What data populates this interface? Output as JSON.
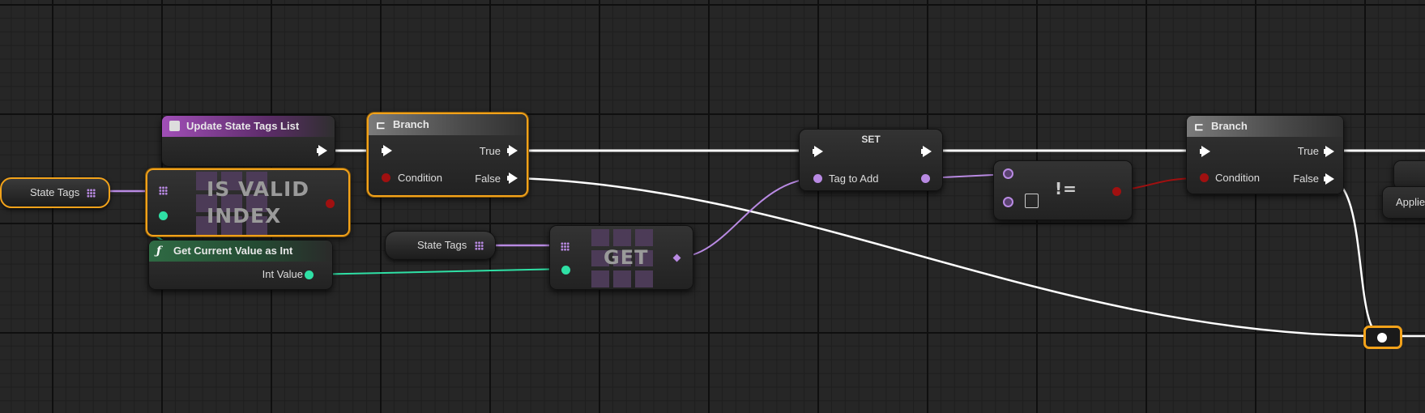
{
  "canvas": {
    "wire_exec_color": "#ffffff",
    "wire_array_color": "#b98ae3",
    "wire_int_color": "#2fe0a5",
    "wire_bool_color": "#a01010",
    "selection_color": "#f2a21a"
  },
  "nodes": {
    "update_state_tags": {
      "title": "Update State Tags List",
      "icon": "function-box-icon"
    },
    "branch1": {
      "title": "Branch",
      "pin_true": "True",
      "pin_false": "False",
      "pin_condition": "Condition"
    },
    "is_valid_index": {
      "op_line1": "IS VALID",
      "op_line2": "INDEX"
    },
    "state_tags_var1": {
      "label": "State Tags"
    },
    "state_tags_var2": {
      "label": "State Tags"
    },
    "get_current_value": {
      "title": "Get Current Value as Int",
      "icon_glyph": "ƒ",
      "pin_out": "Int Value"
    },
    "get_node": {
      "op": "GET"
    },
    "set_node": {
      "title": "SET",
      "pin_in": "Tag to Add"
    },
    "not_equal": {
      "op": "!="
    },
    "branch2": {
      "title": "Branch",
      "pin_true": "True",
      "pin_false": "False",
      "pin_condition": "Condition"
    },
    "partial_node": {
      "pin_label": "Applie"
    }
  }
}
